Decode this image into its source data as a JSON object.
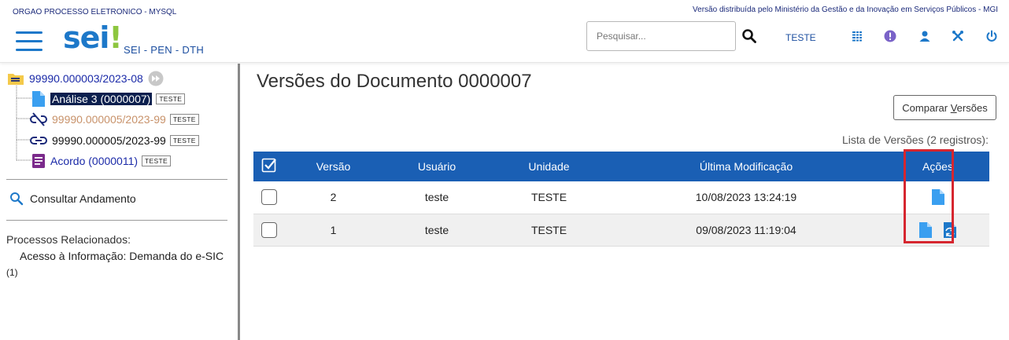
{
  "header": {
    "org_name": "ORGAO PROCESSO ELETRONICO - MYSQL",
    "version_note": "Versão distribuída pelo Ministério da Gestão e da Inovação em Serviços Públicos - MGI",
    "logo_text": "sei",
    "logo_exclamation": "!",
    "system_name": "SEI - PEN - DTH",
    "search_placeholder": "Pesquisar...",
    "unit": "TESTE",
    "icons": [
      "menu-icon",
      "search-icon",
      "list-icon",
      "alert-icon",
      "user-icon",
      "tools-icon",
      "power-icon"
    ]
  },
  "sidebar": {
    "root": {
      "label": "99990.000003/2023-08",
      "icon": "folder-icon"
    },
    "items": [
      {
        "label": "Análise 3 (0000007)",
        "tag": "TESTE",
        "icon": "document-icon",
        "selected": true,
        "color": "#ffffff"
      },
      {
        "label": "99990.000005/2023-99",
        "tag": "TESTE",
        "icon": "unlink-icon",
        "color": "#c8926a"
      },
      {
        "label": "99990.000005/2023-99",
        "tag": "TESTE",
        "icon": "link-icon",
        "color": "#111111"
      },
      {
        "label": "Acordo (0000011)",
        "tag": "TESTE",
        "icon": "form-icon",
        "color": "#1b2aa8"
      }
    ],
    "consultar": "Consultar Andamento",
    "related_title": "Processos Relacionados:",
    "related_item": "Acesso à Informação: Demanda do e-SIC",
    "related_count": "(1)"
  },
  "main": {
    "title": "Versões do Documento 0000007",
    "compare_button_pre": "Comparar ",
    "compare_button_u": "V",
    "compare_button_post": "ersões",
    "caption": "Lista de Versões (2 registros):",
    "columns": [
      "Versão",
      "Usuário",
      "Unidade",
      "Última Modificação",
      "Ações"
    ],
    "rows": [
      {
        "version": "2",
        "user": "teste",
        "unit": "TESTE",
        "modified": "10/08/2023 13:24:19",
        "actions": [
          "view-document-icon"
        ]
      },
      {
        "version": "1",
        "user": "teste",
        "unit": "TESTE",
        "modified": "09/08/2023 11:19:04",
        "actions": [
          "view-document-icon",
          "restore-version-icon"
        ]
      }
    ]
  },
  "colors": {
    "accent": "#1d78c9",
    "table_header": "#1a5fb4",
    "highlight": "#d6262f",
    "logo_exclamation": "#8dc63f"
  }
}
